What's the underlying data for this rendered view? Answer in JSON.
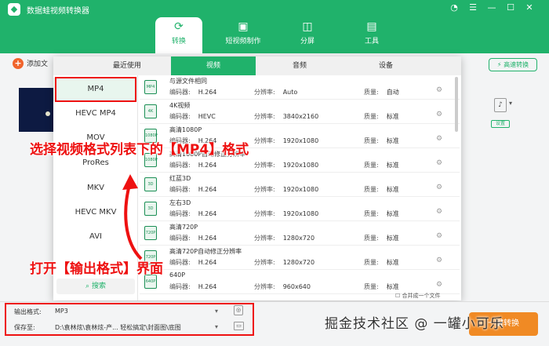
{
  "app": {
    "title": "数据蛙视频转换器",
    "logo_icon": "app-logo-icon"
  },
  "window_controls": [
    "skin-icon",
    "menu-icon",
    "minimize-icon",
    "maximize-icon",
    "close-icon"
  ],
  "nav": {
    "tabs": [
      {
        "label": "转换",
        "icon": "convert-icon",
        "active": true
      },
      {
        "label": "短视频制作",
        "icon": "image-icon",
        "active": false
      },
      {
        "label": "分屏",
        "icon": "split-screen-icon",
        "active": false
      },
      {
        "label": "工具",
        "icon": "toolbox-icon",
        "active": false
      }
    ]
  },
  "toolbar": {
    "add_file": "添加文",
    "fast_convert": "高速转换"
  },
  "file_item": {
    "settings_label": "设置"
  },
  "popup": {
    "tabs": [
      "最近使用",
      "视频",
      "音频",
      "设备"
    ],
    "active_tab": "视频",
    "formats": [
      "MP4",
      "HEVC MP4",
      "MOV",
      "ProRes",
      "MKV",
      "HEVC MKV",
      "AVI"
    ],
    "selected_format": "MP4",
    "search_label": "搜索",
    "presets": [
      {
        "name": "与源文件相同",
        "encoder_label": "编码器:",
        "encoder": "H.264",
        "resolution_label": "分辨率:",
        "resolution": "Auto",
        "quality_label": "质量:",
        "quality": "自动",
        "icon": "MP4"
      },
      {
        "name": "4K视频",
        "encoder_label": "编码器:",
        "encoder": "HEVC",
        "resolution_label": "分辨率:",
        "resolution": "3840x2160",
        "quality_label": "质量:",
        "quality": "标准",
        "icon": "4K"
      },
      {
        "name": "高清1080P",
        "encoder_label": "编码器:",
        "encoder": "H.264",
        "resolution_label": "分辨率:",
        "resolution": "1920x1080",
        "quality_label": "质量:",
        "quality": "标准",
        "icon": "1080P"
      },
      {
        "name": "高清1080P自动修正分辨率",
        "encoder_label": "编码器:",
        "encoder": "H.264",
        "resolution_label": "分辨率:",
        "resolution": "1920x1080",
        "quality_label": "质量:",
        "quality": "标准",
        "icon": "1080P"
      },
      {
        "name": "红蓝3D",
        "encoder_label": "编码器:",
        "encoder": "H.264",
        "resolution_label": "分辨率:",
        "resolution": "1920x1080",
        "quality_label": "质量:",
        "quality": "标准",
        "icon": "3D"
      },
      {
        "name": "左右3D",
        "encoder_label": "编码器:",
        "encoder": "H.264",
        "resolution_label": "分辨率:",
        "resolution": "1920x1080",
        "quality_label": "质量:",
        "quality": "标准",
        "icon": "3D"
      },
      {
        "name": "高清720P",
        "encoder_label": "编码器:",
        "encoder": "H.264",
        "resolution_label": "分辨率:",
        "resolution": "1280x720",
        "quality_label": "质量:",
        "quality": "标准",
        "icon": "720P"
      },
      {
        "name": "高清720P自动修正分辨率",
        "encoder_label": "编码器:",
        "encoder": "H.264",
        "resolution_label": "分辨率:",
        "resolution": "1280x720",
        "quality_label": "质量:",
        "quality": "标准",
        "icon": "720P"
      },
      {
        "name": "640P",
        "encoder_label": "编码器:",
        "encoder": "H.264",
        "resolution_label": "分辨率:",
        "resolution": "960x640",
        "quality_label": "质量:",
        "quality": "标准",
        "icon": "640P"
      }
    ]
  },
  "bottom": {
    "output_label": "输出格式:",
    "output_value": "MP3",
    "save_label": "保存至:",
    "save_path": "D:\\袁林炫\\袁林炫-产...   轻松搞定\\封面图\\底图",
    "merge_label": "合并成一个文件",
    "convert_button": "一键转换"
  },
  "annotations": {
    "select_format": "选择视频格式列表下的【MP4】格式",
    "open_output": "打开【输出格式】界面"
  },
  "watermark": "掘金技术社区 @ 一罐小可乐",
  "colors": {
    "brand": "#20b26b",
    "accent": "#f08a24",
    "annotation": "#ee1111"
  }
}
